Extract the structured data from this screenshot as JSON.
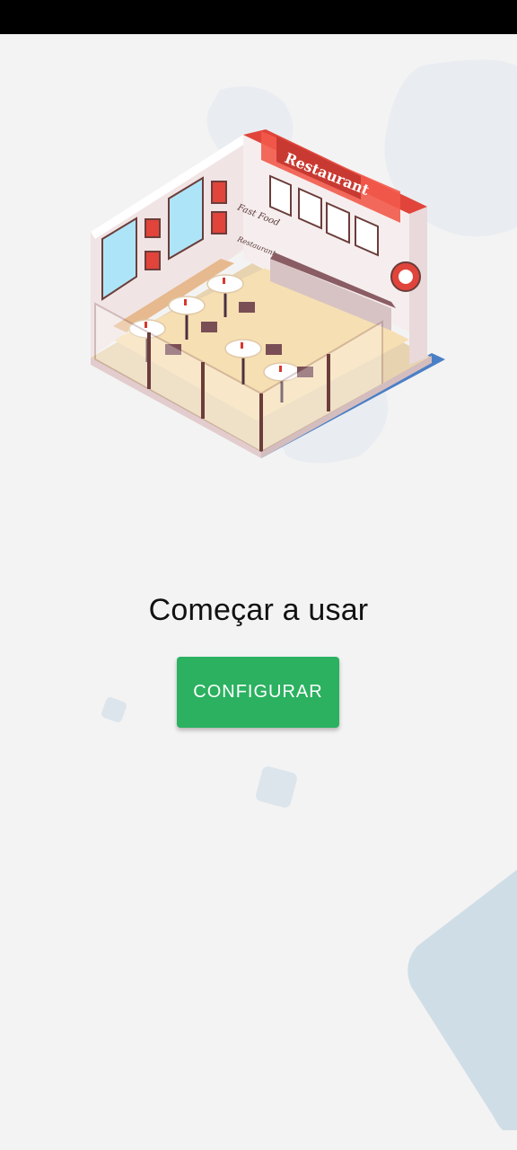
{
  "main": {
    "title": "Começar a usar",
    "configure_label": "CONFIGURAR"
  },
  "illustration": {
    "sign_text": "Restaurant",
    "wall_text_1": "Fast Food",
    "wall_text_2": "Restaurant",
    "icon": "restaurant-illustration"
  },
  "colors": {
    "background": "#f3f3f3",
    "button": "#2bb160",
    "accent_red": "#e0443a",
    "deco_blue": "#cfdde6"
  }
}
